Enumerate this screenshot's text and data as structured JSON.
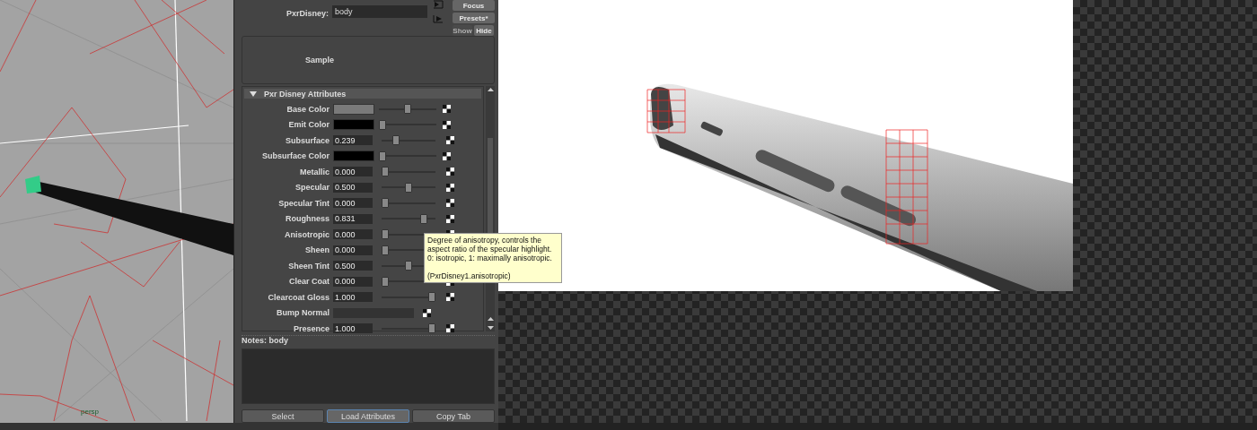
{
  "viewport": {
    "camera_label": "persp"
  },
  "attribute_editor": {
    "node_label": "PxrDisney:",
    "node_name": "body",
    "buttons": [
      {
        "label": "Focus",
        "disabled": false
      },
      {
        "label": "Presets*",
        "disabled": false
      }
    ],
    "visibility_buttons": [
      {
        "label": "Show",
        "disabled": true
      },
      {
        "label": "Hide",
        "disabled": false
      }
    ],
    "sample_label": "Sample",
    "section": {
      "title": "Pxr  Disney Attributes",
      "expanded": true,
      "attributes": [
        {
          "kind": "color",
          "label": "Base Color",
          "color": "#7a7a7a",
          "level": 0.5
        },
        {
          "kind": "color",
          "label": "Emit Color",
          "color": "#000000",
          "level": 0
        },
        {
          "kind": "float",
          "label": "Subsurface",
          "value": "0.239",
          "level": 0.239
        },
        {
          "kind": "color",
          "label": "Subsurface Color",
          "color": "#000000",
          "level": 0
        },
        {
          "kind": "float",
          "label": "Metallic",
          "value": "0.000",
          "level": 0
        },
        {
          "kind": "float",
          "label": "Specular",
          "value": "0.500",
          "level": 0.5
        },
        {
          "kind": "float",
          "label": "Specular Tint",
          "value": "0.000",
          "level": 0
        },
        {
          "kind": "float",
          "label": "Roughness",
          "value": "0.831",
          "level": 0.831
        },
        {
          "kind": "float",
          "label": "Anisotropic",
          "value": "0.000",
          "level": 0
        },
        {
          "kind": "float",
          "label": "Sheen",
          "value": "0.000",
          "level": 0
        },
        {
          "kind": "float",
          "label": "Sheen Tint",
          "value": "0.500",
          "level": 0.5
        },
        {
          "kind": "float",
          "label": "Clear Coat",
          "value": "0.000",
          "level": 0
        },
        {
          "kind": "float",
          "label": "Clearcoat Gloss",
          "value": "1.000",
          "level": 1
        },
        {
          "kind": "normal",
          "label": "Bump Normal"
        },
        {
          "kind": "float",
          "label": "Presence",
          "value": "1.000",
          "level": 1
        }
      ]
    },
    "tooltip": {
      "text": "Degree of anisotropy, controls the aspect ratio of the specular highlight. 0: isotropic, 1: maximally anisotropic.",
      "attribute_path": "(PxrDisney1.anisotropic)"
    },
    "notes_label": "Notes:  body",
    "bottom_buttons": [
      {
        "label": "Select",
        "selected": false
      },
      {
        "label": "Load Attributes",
        "selected": true
      },
      {
        "label": "Copy Tab",
        "selected": false
      }
    ]
  }
}
